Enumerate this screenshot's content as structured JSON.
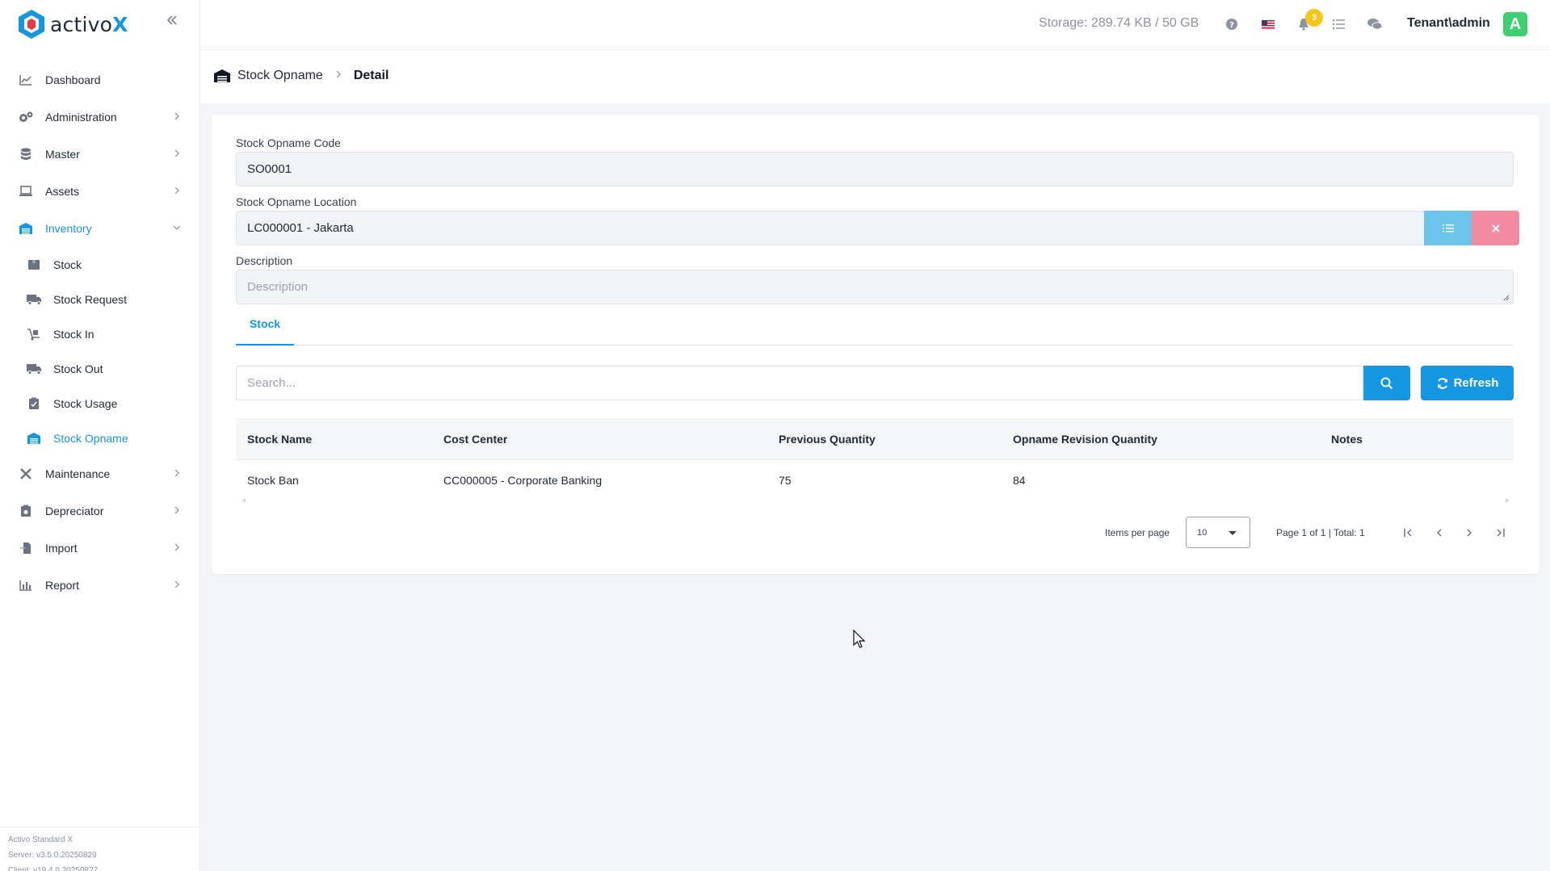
{
  "brand": {
    "name_plain": "activo",
    "name_accent": "X"
  },
  "sidebar": {
    "items": [
      {
        "label": "Dashboard",
        "icon": "chart-line-icon",
        "has_chevron": false
      },
      {
        "label": "Administration",
        "icon": "gears-icon",
        "has_chevron": true
      },
      {
        "label": "Master",
        "icon": "database-icon",
        "has_chevron": true
      },
      {
        "label": "Assets",
        "icon": "laptop-icon",
        "has_chevron": true
      },
      {
        "label": "Inventory",
        "icon": "warehouse-icon",
        "has_chevron": true,
        "expanded": true,
        "active": true
      },
      {
        "label": "Maintenance",
        "icon": "tools-icon",
        "has_chevron": true
      },
      {
        "label": "Depreciator",
        "icon": "clipboard-money-icon",
        "has_chevron": true
      },
      {
        "label": "Import",
        "icon": "file-import-icon",
        "has_chevron": true
      },
      {
        "label": "Report",
        "icon": "bar-chart-icon",
        "has_chevron": true
      }
    ],
    "inventory_sub": [
      {
        "label": "Stock",
        "icon": "box-icon"
      },
      {
        "label": "Stock Request",
        "icon": "truck-icon"
      },
      {
        "label": "Stock In",
        "icon": "dolly-icon"
      },
      {
        "label": "Stock Out",
        "icon": "truck-moving-icon"
      },
      {
        "label": "Stock Usage",
        "icon": "clipboard-check-icon"
      },
      {
        "label": "Stock Opname",
        "icon": "warehouse-icon",
        "active": true
      }
    ],
    "footer": {
      "product": "Activo Standard X",
      "server": "Server: v3.5.0.20250829",
      "client": "Client: v19.4.0.20250827"
    }
  },
  "topbar": {
    "storage": "Storage: 289.74 KB / 50 GB",
    "notification_count": "3",
    "user": "Tenant\\admin",
    "avatar_letter": "A"
  },
  "breadcrumb": {
    "parent": "Stock Opname",
    "current": "Detail"
  },
  "form": {
    "code_label": "Stock Opname Code",
    "code_value": "SO0001",
    "location_label": "Stock Opname Location",
    "location_value": "LC000001 - Jakarta",
    "description_label": "Description",
    "description_placeholder": "Description"
  },
  "tabs": [
    {
      "label": "Stock",
      "active": true
    }
  ],
  "search": {
    "placeholder": "Search...",
    "refresh_label": "Refresh"
  },
  "table": {
    "headers": [
      "Stock Name",
      "Cost Center",
      "Previous Quantity",
      "Opname Revision Quantity",
      "Notes"
    ],
    "rows": [
      [
        "Stock Ban",
        "CC000005 - Corporate Banking",
        "75",
        "84",
        ""
      ]
    ]
  },
  "pagination": {
    "items_per_page_label": "Items per page",
    "items_per_page_value": "10",
    "page_info": "Page 1 of 1 | Total: 1"
  },
  "colors": {
    "accent": "#1596e0",
    "location_select_button": "#6cc4ea",
    "location_clear_button": "#f28ba0",
    "avatar": "#3ecf71",
    "badge": "#f5c518"
  }
}
